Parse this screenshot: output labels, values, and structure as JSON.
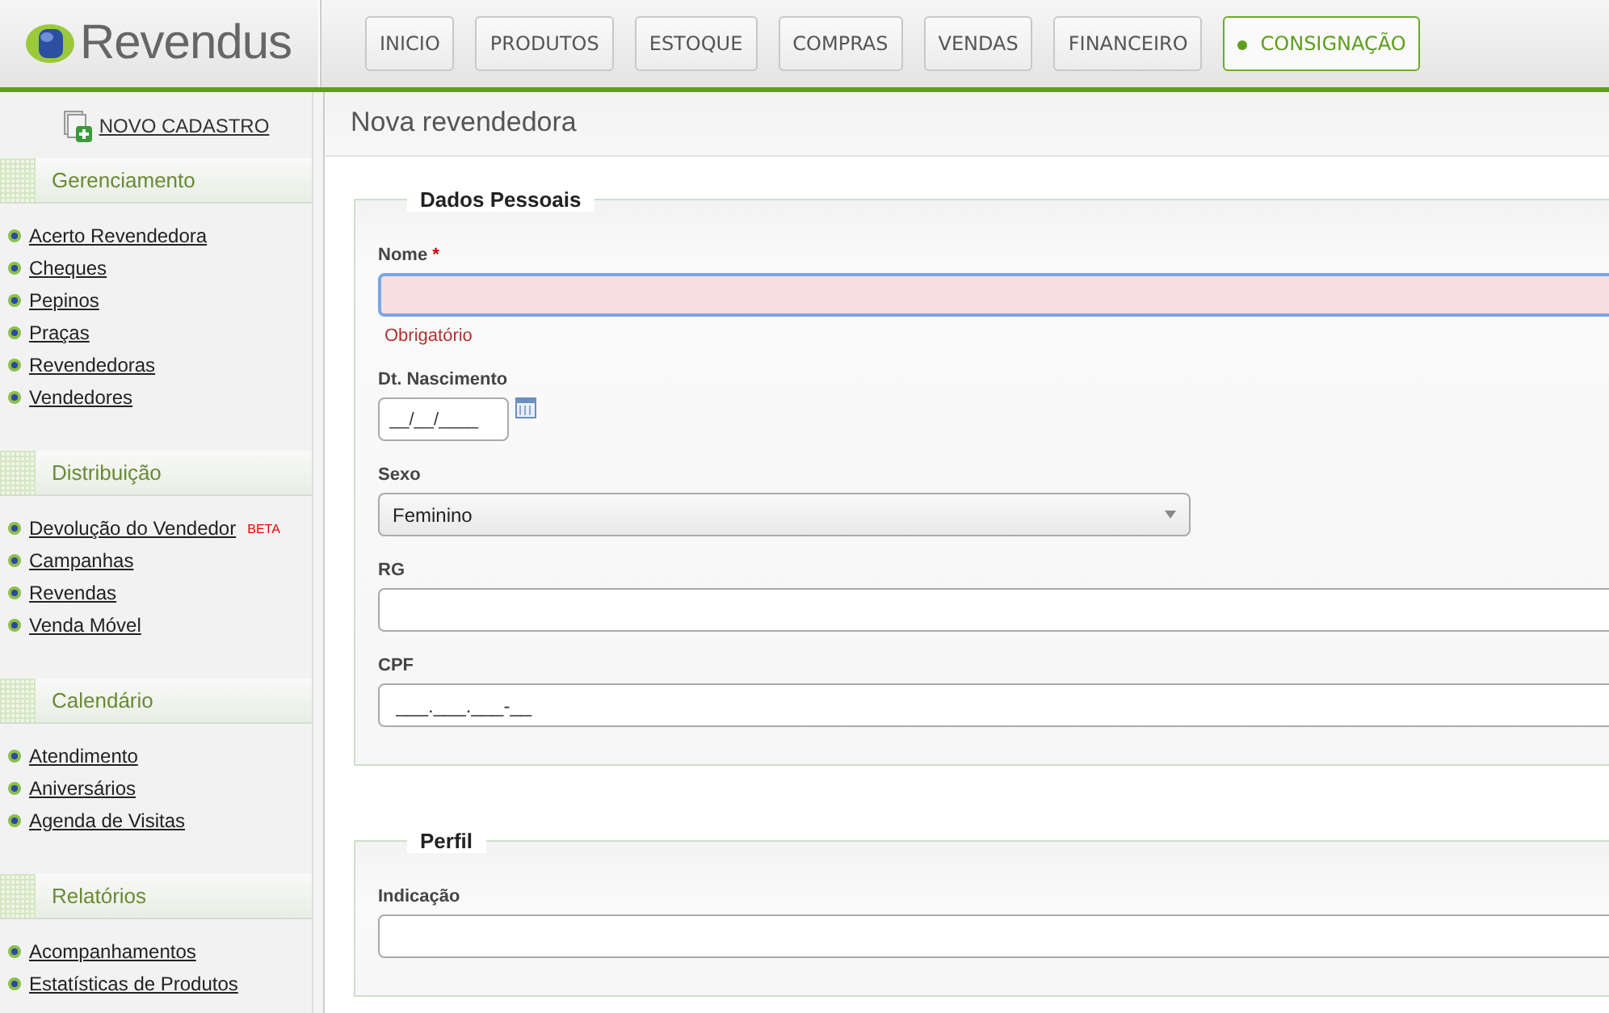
{
  "logo": {
    "text": "Revendus"
  },
  "nav": [
    {
      "label": "INICIO",
      "selected": false
    },
    {
      "label": "PRODUTOS",
      "selected": false
    },
    {
      "label": "ESTOQUE",
      "selected": false
    },
    {
      "label": "COMPRAS",
      "selected": false
    },
    {
      "label": "VENDAS",
      "selected": false
    },
    {
      "label": "FINANCEIRO",
      "selected": false
    },
    {
      "label": "CONSIGNAÇÃO",
      "selected": true
    }
  ],
  "sidebar": {
    "new_button": "NOVO CADASTRO",
    "sections": [
      {
        "title": "Gerenciamento",
        "items": [
          {
            "label": "Acerto Revendedora"
          },
          {
            "label": "Cheques"
          },
          {
            "label": "Pepinos"
          },
          {
            "label": "Praças"
          },
          {
            "label": "Revendedoras"
          },
          {
            "label": "Vendedores"
          }
        ]
      },
      {
        "title": "Distribuição",
        "items": [
          {
            "label": "Devolução do Vendedor",
            "badge": "BETA"
          },
          {
            "label": "Campanhas"
          },
          {
            "label": "Revendas"
          },
          {
            "label": "Venda Móvel"
          }
        ]
      },
      {
        "title": "Calendário",
        "items": [
          {
            "label": "Atendimento"
          },
          {
            "label": "Aniversários"
          },
          {
            "label": "Agenda de Visitas"
          }
        ]
      },
      {
        "title": "Relatórios",
        "items": [
          {
            "label": "Acompanhamentos"
          },
          {
            "label": "Estatísticas de Produtos"
          }
        ]
      }
    ]
  },
  "page_title": "Nova revendedora",
  "fieldsets": [
    {
      "legend": "Dados Pessoais",
      "fields": [
        {
          "kind": "text",
          "label": "Nome",
          "required_mark": "*",
          "invalid": true,
          "focused": true,
          "error": "Obrigatório"
        },
        {
          "kind": "date",
          "label": "Dt. Nascimento",
          "placeholder": "__/__/____"
        },
        {
          "kind": "select",
          "label": "Sexo",
          "value": "Feminino"
        },
        {
          "kind": "text",
          "label": "RG"
        },
        {
          "kind": "text",
          "label": "CPF",
          "placeholder": "___.___.___-__"
        }
      ]
    },
    {
      "legend": "Perfil",
      "fields": [
        {
          "kind": "text",
          "label": "Indicação"
        }
      ]
    }
  ]
}
